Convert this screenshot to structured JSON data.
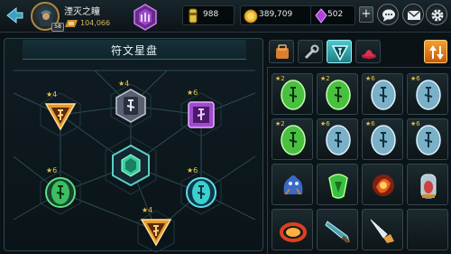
{
  "player": {
    "name": "湮灭之瞳",
    "level": "58",
    "power": "104,066"
  },
  "resources": {
    "energy": "988",
    "gold": "389,709",
    "gems": "502"
  },
  "panel": {
    "title": "符文星盘"
  },
  "icons": {
    "chat": "chat-bubble-icon",
    "mail": "envelope-icon",
    "settings": "gear-icon",
    "sort": "sort-arrows-icon"
  },
  "rune_nodes": [
    {
      "id": "top-left",
      "stars": "4",
      "shape": "triangle",
      "color": "#e89a2a"
    },
    {
      "id": "top",
      "stars": "4",
      "shape": "hex",
      "color": "#8a8fa0"
    },
    {
      "id": "top-right",
      "stars": "6",
      "shape": "square",
      "color": "#a04ad0"
    },
    {
      "id": "center",
      "stars": "",
      "shape": "hex",
      "color": "#3ad0a0"
    },
    {
      "id": "left",
      "stars": "6",
      "shape": "circle",
      "color": "#3ac060"
    },
    {
      "id": "right",
      "stars": "6",
      "shape": "circle",
      "color": "#3ad0d0"
    },
    {
      "id": "bottom",
      "stars": "4",
      "shape": "triangle",
      "color": "#e89a2a"
    }
  ],
  "inventory": [
    {
      "stars": "2",
      "type": "rune-stone",
      "color": "#4ac040"
    },
    {
      "stars": "2",
      "type": "rune-stone",
      "color": "#4ac040"
    },
    {
      "stars": "6",
      "type": "rune-stone",
      "color": "#7ab0c8"
    },
    {
      "stars": "6",
      "type": "rune-stone",
      "color": "#7ab0c8"
    },
    {
      "stars": "2",
      "type": "rune-stone",
      "color": "#4ac040"
    },
    {
      "stars": "6",
      "type": "rune-stone",
      "color": "#7ab0c8"
    },
    {
      "stars": "6",
      "type": "rune-stone",
      "color": "#7ab0c8"
    },
    {
      "stars": "6",
      "type": "rune-stone",
      "color": "#7ab0c8"
    },
    {
      "stars": "",
      "type": "blue-creature",
      "color": "#3a6ac8"
    },
    {
      "stars": "",
      "type": "green-gem",
      "color": "#3ac040"
    },
    {
      "stars": "",
      "type": "fire-orb",
      "color": "#d85020"
    },
    {
      "stars": "",
      "type": "jar",
      "color": "#d04040"
    },
    {
      "stars": "",
      "type": "fire-ring",
      "color": "#e04020"
    },
    {
      "stars": "",
      "type": "blade",
      "color": "#4aa0b0"
    },
    {
      "stars": "",
      "type": "dagger",
      "color": "#e0a040"
    },
    {
      "stars": "",
      "type": "empty",
      "color": "#1a2428"
    }
  ]
}
